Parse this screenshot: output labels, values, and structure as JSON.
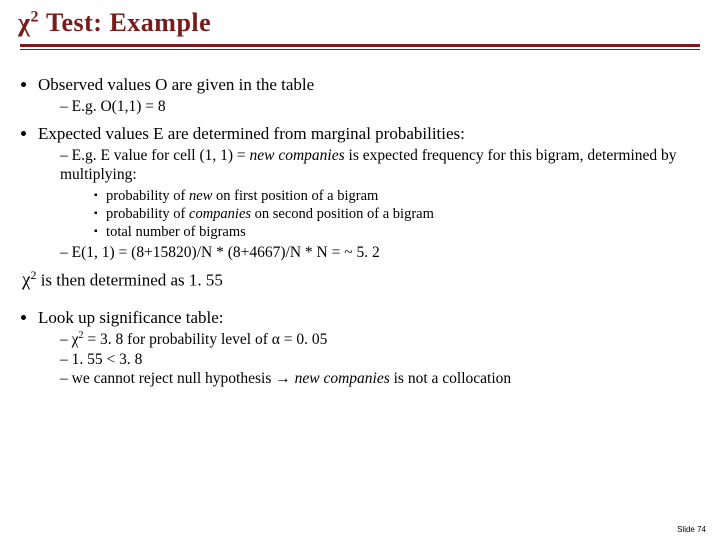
{
  "title_prefix_chi": "χ",
  "title_sup": "2",
  "title_rest": " Test: Example",
  "p1": "Observed values O are given in the table",
  "p1a": "E.g. O(1,1) = 8",
  "p2": "Expected values E are determined from marginal probabilities:",
  "p2a_pre": "E.g. E value for cell (1, 1) = ",
  "p2a_em": "new companies",
  "p2a_post": " is expected frequency for this bigram, determined by multiplying:",
  "p2a_i_pre": "probability of ",
  "p2a_i_em": "new",
  "p2a_i_post": " on first position of a bigram",
  "p2a_ii_pre": "probability of ",
  "p2a_ii_em": "companies",
  "p2a_ii_post": " on second position of a bigram",
  "p2a_iii": "total number of bigrams",
  "p2b": "E(1, 1) = (8+15820)/N * (8+4667)/N * N = ~ 5. 2",
  "chi_sym": "χ",
  "chi_sup": "2",
  "chi_rest": " is then determined as 1. 55",
  "p3": "Look up significance table:",
  "p3a_chi": "χ",
  "p3a_sup": "2",
  "p3a_mid": " = 3. 8 for probability level of α = 0. 05",
  "p3b": "1. 55 < 3. 8",
  "p3c_pre": "we cannot reject null hypothesis → ",
  "p3c_em": "new companies",
  "p3c_post": " is not a collocation",
  "slide_num": "Slide 74"
}
